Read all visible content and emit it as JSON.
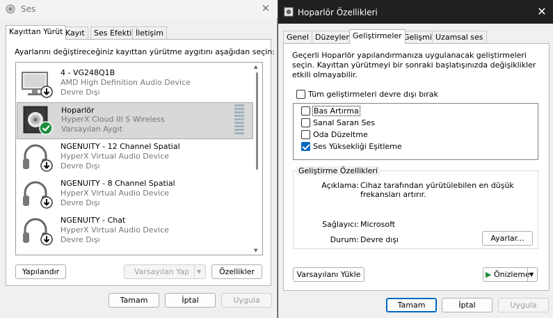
{
  "ses_window": {
    "title": "Ses",
    "tabs": [
      {
        "label": "Kayıttan Yürüt"
      },
      {
        "label": "Kayıt"
      },
      {
        "label": "Ses Efekti"
      },
      {
        "label": "İletişim"
      }
    ],
    "instruction": "Ayarlarını değiştireceğiniz kayıttan yürütme aygıtını aşağıdan seçin:",
    "devices": [
      {
        "name": "4 - VG248Q1B",
        "driver": "AMD High Definition Audio Device",
        "status": "Devre Dışı",
        "icon": "monitor-icon"
      },
      {
        "name": "Hoparlör",
        "driver": "HyperX Cloud III S Wireless",
        "status": "Varsayılan Aygıt",
        "icon": "speaker-icon"
      },
      {
        "name": "NGENUITY - 12 Channel Spatial",
        "driver": "HyperX Virtual Audio Device",
        "status": "Devre Dışı",
        "icon": "headphones-icon"
      },
      {
        "name": "NGENUITY - 8 Channel Spatial",
        "driver": "HyperX Virtual Audio Device",
        "status": "Devre Dışı",
        "icon": "headphones-icon"
      },
      {
        "name": "NGENUITY - Chat",
        "driver": "HyperX Virtual Audio Device",
        "status": "Devre Dışı",
        "icon": "headphones-icon"
      }
    ],
    "buttons": {
      "configure": "Yapılandır",
      "set_default": "Varsayılan Yap",
      "properties": "Özellikler",
      "ok": "Tamam",
      "cancel": "İptal",
      "apply": "Uygula"
    }
  },
  "hoparlor_window": {
    "title": "Hoparlör Özellikleri",
    "tabs": [
      {
        "label": "Genel"
      },
      {
        "label": "Düzeyler"
      },
      {
        "label": "Geliştirmeler"
      },
      {
        "label": "Gelişmiş"
      },
      {
        "label": "Uzamsal ses"
      }
    ],
    "description": "Geçerli Hoparlör yapılandırmanıza uygulanacak geliştirmeleri seçin. Kayıttan yürütmeyi bir sonraki başlatışınızda değişiklikler etkili olmayabilir.",
    "disable_all_label": "Tüm geliştirmeleri devre dışı bırak",
    "disable_all_checked": false,
    "enhancements": [
      {
        "label": "Bas Artırma",
        "checked": false
      },
      {
        "label": "Sanal Saran Ses",
        "checked": false
      },
      {
        "label": "Oda Düzeltme",
        "checked": false
      },
      {
        "label": "Ses Yüksekliği Eşitleme",
        "checked": true
      }
    ],
    "properties_group": {
      "title": "Geliştirme Özellikleri",
      "description_label": "Açıklama:",
      "description_value": "Cihaz tarafından yürütülebilen en düşük frekansları artırır.",
      "provider_label": "Sağlayıcı:",
      "provider_value": "Microsoft",
      "status_label": "Durum:",
      "status_value": "Devre dışı",
      "settings_button": "Ayarlar..."
    },
    "buttons": {
      "restore_defaults": "Varsayılanı Yükle",
      "preview": "Önizleme",
      "ok": "Tamam",
      "cancel": "İptal",
      "apply": "Uygula"
    }
  }
}
